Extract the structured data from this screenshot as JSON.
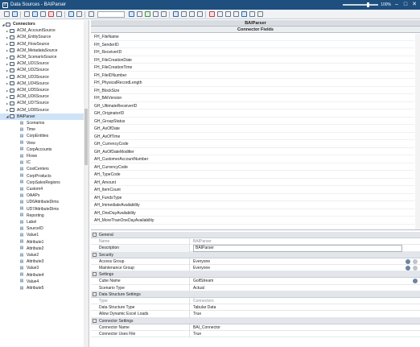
{
  "window": {
    "title": "Data Sources - BAIParser",
    "zoom": "100%",
    "colors": {
      "titlebar": "#1e4f7e",
      "selection": "#cfe3f7"
    }
  },
  "tree": {
    "root": "Connectors",
    "items": [
      "ACM_AccountSource",
      "ACM_EntitySource",
      "ACM_FlowSource",
      "ACM_MetadataSource",
      "ACM_ScenarioSource",
      "ACM_UD1Source",
      "ACM_UD2Source",
      "ACM_UD3Source",
      "ACM_UD4Source",
      "ACM_UD5Source",
      "ACM_UD6Source",
      "ACM_UD7Source",
      "ACM_UD8Source"
    ],
    "selected": "BAIParser",
    "children": [
      "Scenarios",
      "Time",
      "CorpEntities",
      "View",
      "CorpAccounts",
      "Flows",
      "IC",
      "CostCenters",
      "CorpProducts",
      "CorpSalesRegions",
      "Custom4",
      "OAAPs",
      "UD6AttributeDims",
      "UD7AttributeDims",
      "Reporting",
      "Label",
      "SourceID",
      "Value1",
      "Attribute1",
      "Attribute2",
      "Value2",
      "Attribute3",
      "Value3",
      "Attribute4",
      "Value4",
      "Attribute5"
    ]
  },
  "main": {
    "header": "BAIParser",
    "subheader": "Connector Fields",
    "fields": [
      "FH_FileName",
      "FH_SenderID",
      "FH_ReceiverID",
      "FH_FileCreationDate",
      "FH_FileCreationTime",
      "FH_FileIDNumber",
      "FH_PhysicalRecordLength",
      "FH_BlockSize",
      "FH_BAIVersion",
      "GH_UltimateReceiverID",
      "GH_OriginatorID",
      "GH_GroupStatus",
      "GH_AsOfDate",
      "GH_AsOfTime",
      "GH_CurrencyCode",
      "GH_AsOfDateModifier",
      "AH_CustomerAccountNumber",
      "AH_CurrencyCode",
      "AH_TypeCode",
      "AH_Amount",
      "AH_ItemCount",
      "AH_FundsType",
      "AH_ImmediateAvailability",
      "AH_OneDayAvailability",
      "AH_MoreThanOneDayAvailability"
    ]
  },
  "properties": {
    "sections": [
      {
        "name": "General",
        "rows": [
          {
            "name": "Name",
            "value": "BAIParser",
            "dim": true
          },
          {
            "name": "Description",
            "value": "BAIParser",
            "highlight": true
          }
        ]
      },
      {
        "name": "Security",
        "rows": [
          {
            "name": "Access Group",
            "value": "Everyone",
            "dots": true
          },
          {
            "name": "Maintenance Group",
            "value": "Everyone",
            "dots": true
          }
        ]
      },
      {
        "name": "Settings",
        "rows": [
          {
            "name": "Cube Name",
            "value": "GolfStream",
            "dot1": true
          },
          {
            "name": "Scenario Type",
            "value": "Actual"
          }
        ]
      },
      {
        "name": "Data Structure Settings",
        "rows": [
          {
            "name": "Type",
            "value": "Connectors",
            "dim": true
          },
          {
            "name": "Data Structure Type",
            "value": "Tabular Data"
          },
          {
            "name": "Allow Dynamic Excel Loads",
            "value": "True"
          }
        ]
      },
      {
        "name": "Connector Settings",
        "rows": [
          {
            "name": "Connector Name",
            "value": "BAI_Connector"
          },
          {
            "name": "Connector Uses File",
            "value": "True"
          }
        ]
      }
    ]
  }
}
